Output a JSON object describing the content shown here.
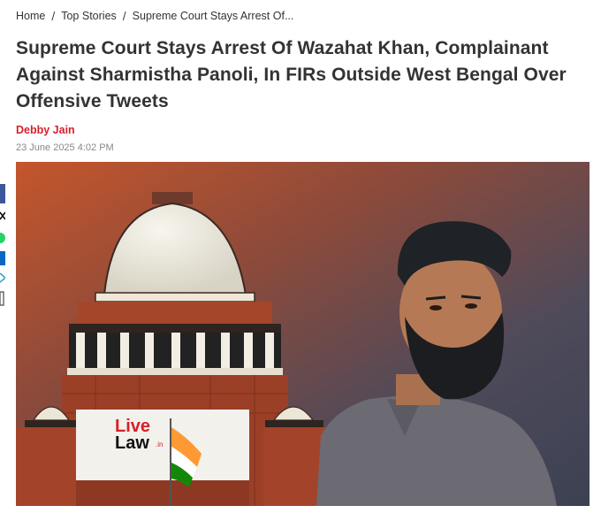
{
  "breadcrumb": {
    "items": [
      "Home",
      "Top Stories",
      "Supreme Court Stays Arrest Of..."
    ],
    "separator": "/"
  },
  "article": {
    "title": "Supreme Court Stays Arrest Of Wazahat Khan, Complainant Against Sharmistha Panoli, In FIRs Outside West Bengal Over Offensive Tweets",
    "author": "Debby Jain",
    "date": "23 June 2025 4:02 PM"
  },
  "hero": {
    "logo_line1": "Live",
    "logo_line2": "Law",
    "logo_suffix": ".in"
  },
  "share": {
    "icons": [
      "facebook-icon",
      "x-icon",
      "whatsapp-icon",
      "linkedin-icon",
      "telegram-icon",
      "copy-link-icon"
    ]
  },
  "colors": {
    "accent": "#d6202a",
    "title": "#333333",
    "meta": "#888888"
  }
}
